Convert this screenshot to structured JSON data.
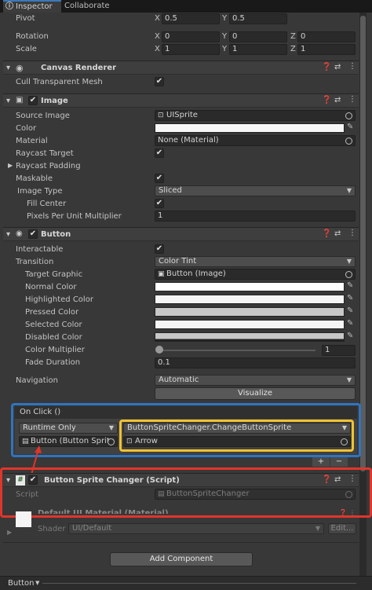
{
  "tabs": {
    "inspector": "Inspector",
    "collaborate": "Collaborate"
  },
  "transform": {
    "pivot_label": "Pivot",
    "pivot_x": "0.5",
    "pivot_y": "0.5",
    "rotation_label": "Rotation",
    "rot_x": "0",
    "rot_y": "0",
    "rot_z": "0",
    "scale_label": "Scale",
    "scale_x": "1",
    "scale_y": "1",
    "scale_z": "1",
    "axis_x": "X",
    "axis_y": "Y",
    "axis_z": "Z"
  },
  "canvas_renderer": {
    "title": "Canvas Renderer",
    "cull_label": "Cull Transparent Mesh"
  },
  "image": {
    "title": "Image",
    "source_label": "Source Image",
    "source_value": "UISprite",
    "color_label": "Color",
    "material_label": "Material",
    "material_value": "None (Material)",
    "raycast_label": "Raycast Target",
    "padding_label": "Raycast Padding",
    "maskable_label": "Maskable",
    "type_label": "Image Type",
    "type_value": "Sliced",
    "fill_label": "Fill Center",
    "ppu_label": "Pixels Per Unit Multiplier",
    "ppu_value": "1"
  },
  "button": {
    "title": "Button",
    "interactable_label": "Interactable",
    "transition_label": "Transition",
    "transition_value": "Color Tint",
    "target_label": "Target Graphic",
    "target_value": "Button (Image)",
    "normal_label": "Normal Color",
    "highlighted_label": "Highlighted Color",
    "pressed_label": "Pressed Color",
    "selected_label": "Selected Color",
    "disabled_label": "Disabled Color",
    "multiplier_label": "Color Multiplier",
    "multiplier_value": "1",
    "fade_label": "Fade Duration",
    "fade_value": "0.1",
    "navigation_label": "Navigation",
    "navigation_value": "Automatic",
    "visualize_label": "Visualize"
  },
  "onclick": {
    "title": "On Click ()",
    "runtime_value": "Runtime Only",
    "function_value": "ButtonSpriteChanger.ChangeButtonSprite",
    "object_value": "Button (Button Sprite C",
    "arg_value": "Arrow",
    "plus": "+",
    "minus": "−"
  },
  "script_component": {
    "title": "Button Sprite Changer (Script)",
    "script_label": "Script",
    "script_value": "ButtonSpriteChanger"
  },
  "material": {
    "name": "Default UI Material (Material)",
    "shader_label": "Shader",
    "shader_value": "UI/Default",
    "edit_label": "Edit..."
  },
  "add_component_label": "Add Component",
  "footer_label": "Button",
  "colors": {
    "highlight_blue": "#2f74c0",
    "highlight_yellow": "#f2c230",
    "highlight_red": "#e0352b"
  }
}
